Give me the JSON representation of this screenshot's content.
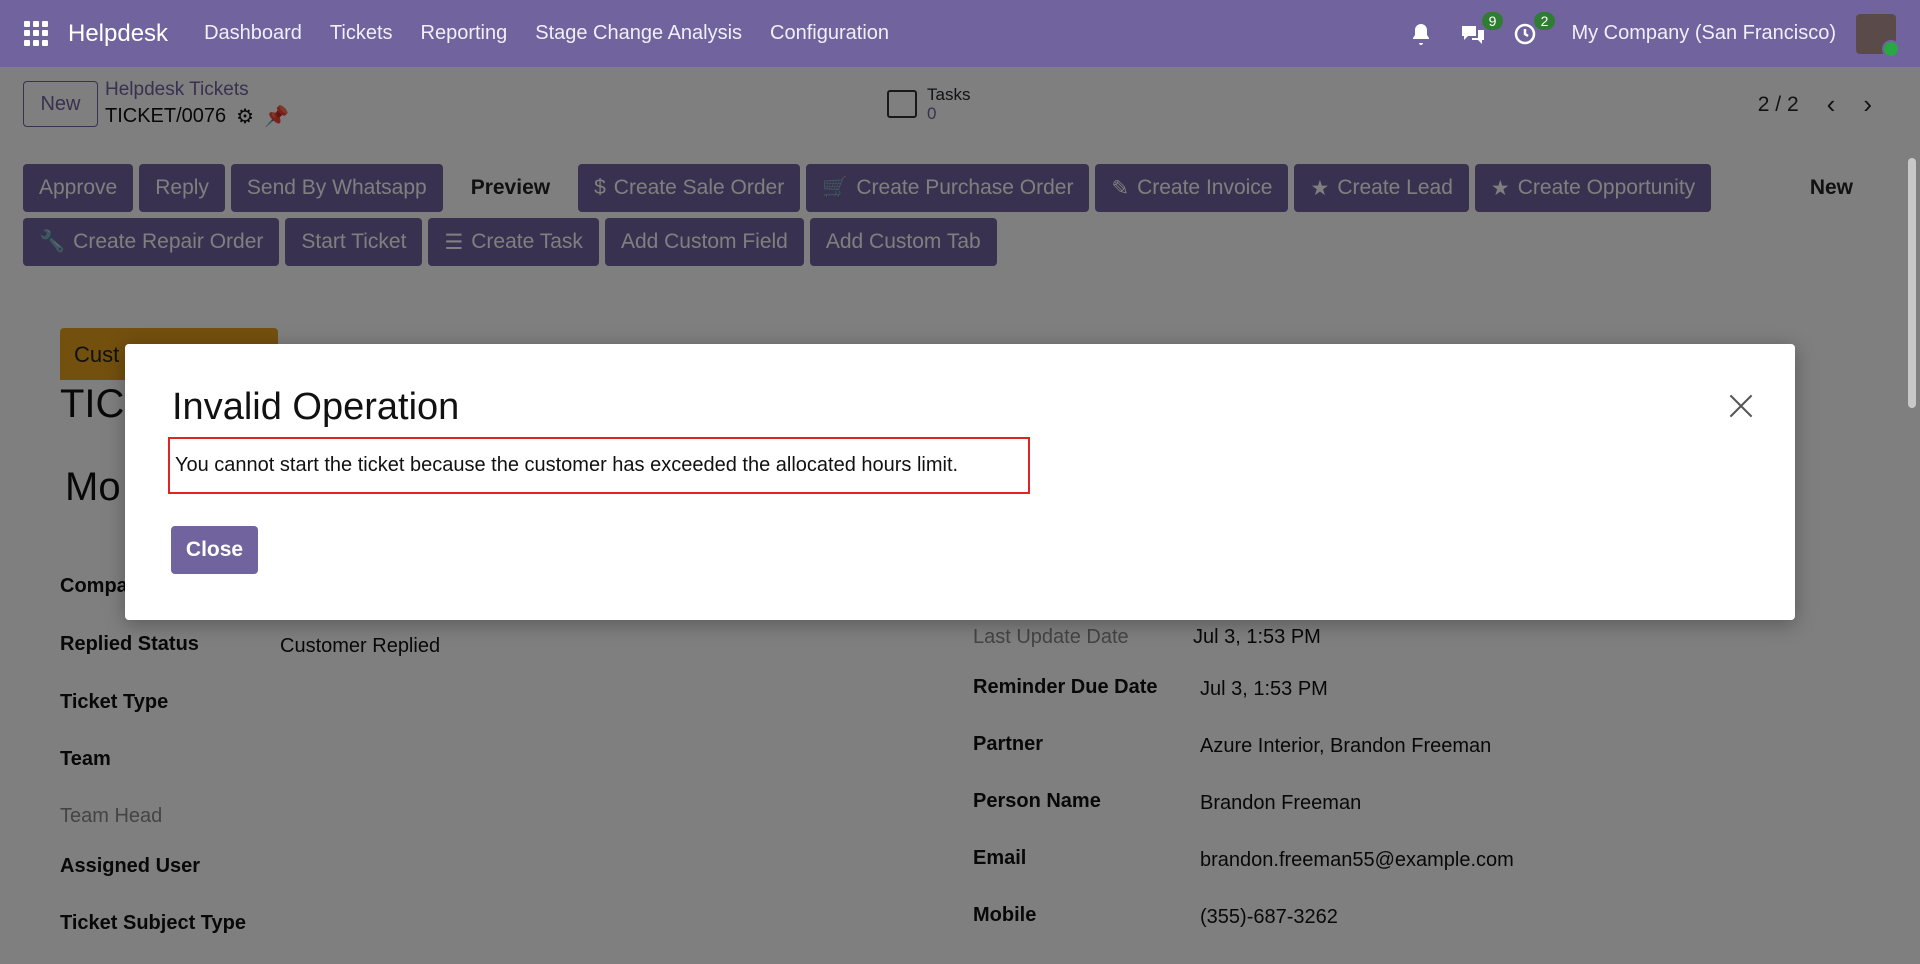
{
  "navbar": {
    "brand": "Helpdesk",
    "menu": [
      "Dashboard",
      "Tickets",
      "Reporting",
      "Stage Change Analysis",
      "Configuration"
    ],
    "messages_badge": "9",
    "activities_badge": "2",
    "company": "My Company (San Francisco)"
  },
  "control": {
    "new_label": "New",
    "breadcrumb_parent": "Helpdesk Tickets",
    "breadcrumb_current": "TICKET/0076",
    "tasks_label": "Tasks",
    "tasks_count": "0",
    "pager": "2 / 2"
  },
  "actions": {
    "row1": [
      "Approve",
      "Reply",
      "Send By Whatsapp",
      "Preview",
      "Create Sale Order",
      "Create Purchase Order",
      "Create Invoice",
      "Create Lead",
      "Create Opportunity"
    ],
    "row1_status": "New",
    "row2": [
      "Create Repair Order",
      "Start Ticket",
      "Create Task",
      "Add Custom Field",
      "Add Custom Tab"
    ]
  },
  "form": {
    "stage_badge": "Cust",
    "ticket_title": "TIC",
    "model_title": "Mo",
    "left_fields": [
      {
        "label": "Compa",
        "value": ""
      },
      {
        "label": "Replied Status",
        "value": "Customer Replied"
      },
      {
        "label": "Ticket Type",
        "value": ""
      },
      {
        "label": "Team",
        "value": ""
      },
      {
        "label": "Team Head",
        "value": ""
      },
      {
        "label": "Assigned User",
        "value": ""
      },
      {
        "label": "Ticket Subject Type",
        "value": ""
      }
    ],
    "right_fields": [
      {
        "label": "Last Update Date",
        "value": "Jul 3, 1:53 PM"
      },
      {
        "label": "Reminder Due Date",
        "value": "Jul 3, 1:53 PM"
      },
      {
        "label": "Partner",
        "value": "Azure Interior, Brandon Freeman"
      },
      {
        "label": "Person Name",
        "value": "Brandon Freeman"
      },
      {
        "label": "Email",
        "value": "brandon.freeman55@example.com"
      },
      {
        "label": "Mobile",
        "value": "(355)-687-3262"
      }
    ]
  },
  "modal": {
    "title": "Invalid Operation",
    "message": "You cannot start the ticket because the customer has exceeded the allocated hours limit.",
    "close_label": "Close"
  },
  "colors": {
    "primary": "#71639e",
    "stage_badge": "#e6a11d",
    "highlight_border": "#e02424"
  }
}
